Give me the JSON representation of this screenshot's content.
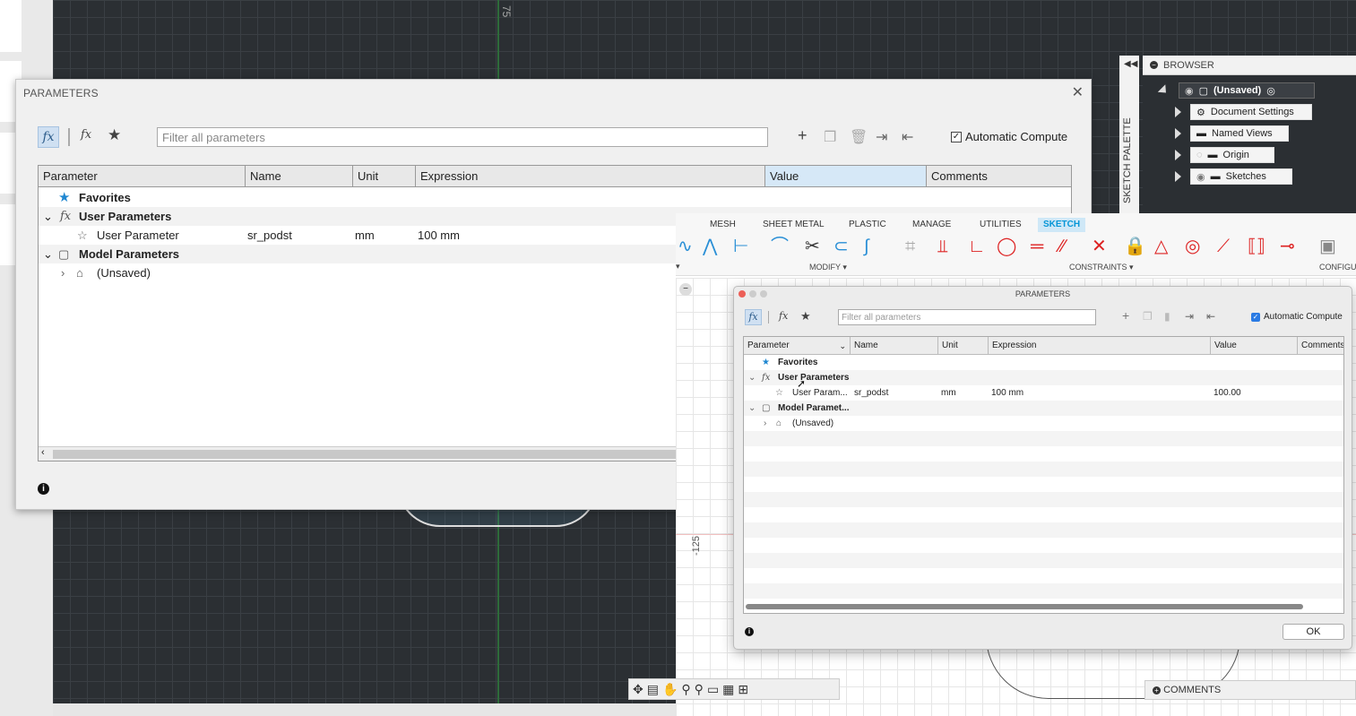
{
  "canvas": {
    "ruler_top": "75",
    "ruler_mid": "-125"
  },
  "palette": {
    "label": "SKETCH PALETTE"
  },
  "browser": {
    "title": "BROWSER",
    "root": "(Unsaved)",
    "items": [
      {
        "label": "Document Settings"
      },
      {
        "label": "Named Views"
      },
      {
        "label": "Origin"
      },
      {
        "label": "Sketches"
      }
    ]
  },
  "dialog_main": {
    "title": "PARAMETERS",
    "filter_placeholder": "Filter all parameters",
    "auto_compute": "Automatic Compute",
    "columns": [
      "Parameter",
      "Name",
      "Unit",
      "Expression",
      "Value",
      "Comments"
    ],
    "rows": {
      "favorites": "Favorites",
      "user_params": "User Parameters",
      "user_param": {
        "parameter": "User Parameter",
        "name": "sr_podst",
        "unit": "mm",
        "expression": "100 mm"
      },
      "model_params": "Model Parameters",
      "unsaved": "(Unsaved)"
    }
  },
  "ribbon": {
    "tabs": [
      "MESH",
      "SHEET METAL",
      "PLASTIC",
      "MANAGE",
      "UTILITIES",
      "SKETCH"
    ],
    "groups": {
      "modify": "MODIFY ▾",
      "constraints": "CONSTRAINTS ▾",
      "configure": "CONFIGU"
    }
  },
  "dialog_mac": {
    "title": "PARAMETERS",
    "filter_placeholder": "Filter all parameters",
    "auto_compute": "Automatic Compute",
    "columns": [
      "Parameter",
      "Name",
      "Unit",
      "Expression",
      "Value",
      "Comments"
    ],
    "rows": {
      "favorites": "Favorites",
      "user_params": "User Parameters",
      "user_param": {
        "parameter": "User Param...",
        "name": "sr_podst",
        "unit": "mm",
        "expression": "100 mm",
        "value": "100.00"
      },
      "model_params": "Model Paramet...",
      "unsaved": "(Unsaved)"
    },
    "ok": "OK"
  },
  "comments": {
    "label": "COMMENTS"
  },
  "colors": {
    "accent": "#2a8fd6",
    "favorite_star": "#1f87d1",
    "tab_active": "#0696d7"
  }
}
